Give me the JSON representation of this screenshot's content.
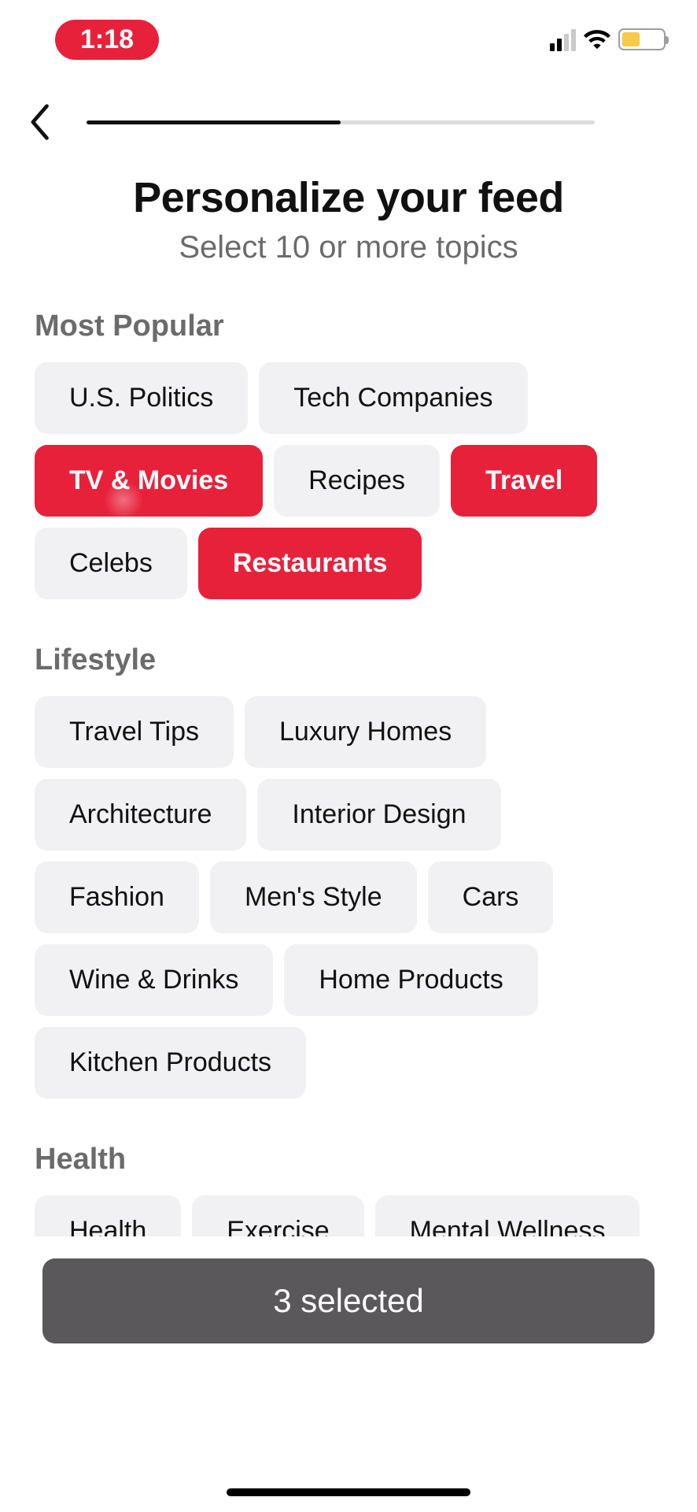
{
  "status_bar": {
    "time": "1:18"
  },
  "progress": {
    "percent": 50
  },
  "header": {
    "title": "Personalize your feed",
    "subtitle": "Select 10 or more topics"
  },
  "sections": [
    {
      "title": "Most Popular",
      "chips": [
        {
          "label": "U.S. Politics",
          "selected": false
        },
        {
          "label": "Tech Companies",
          "selected": false
        },
        {
          "label": "TV & Movies",
          "selected": true
        },
        {
          "label": "Recipes",
          "selected": false
        },
        {
          "label": "Travel",
          "selected": true
        },
        {
          "label": "Celebs",
          "selected": false
        },
        {
          "label": "Restaurants",
          "selected": true
        }
      ]
    },
    {
      "title": "Lifestyle",
      "chips": [
        {
          "label": "Travel Tips",
          "selected": false
        },
        {
          "label": "Luxury Homes",
          "selected": false
        },
        {
          "label": "Architecture",
          "selected": false
        },
        {
          "label": "Interior Design",
          "selected": false
        },
        {
          "label": "Fashion",
          "selected": false
        },
        {
          "label": "Men's Style",
          "selected": false
        },
        {
          "label": "Cars",
          "selected": false
        },
        {
          "label": "Wine & Drinks",
          "selected": false
        },
        {
          "label": "Home Products",
          "selected": false
        },
        {
          "label": "Kitchen Products",
          "selected": false
        }
      ]
    },
    {
      "title": "Health",
      "chips": [
        {
          "label": "Health",
          "selected": false
        },
        {
          "label": "Exercise",
          "selected": false
        },
        {
          "label": "Mental Wellness",
          "selected": false
        }
      ]
    }
  ],
  "cta": {
    "label": "3 selected",
    "selected_count": 3
  }
}
